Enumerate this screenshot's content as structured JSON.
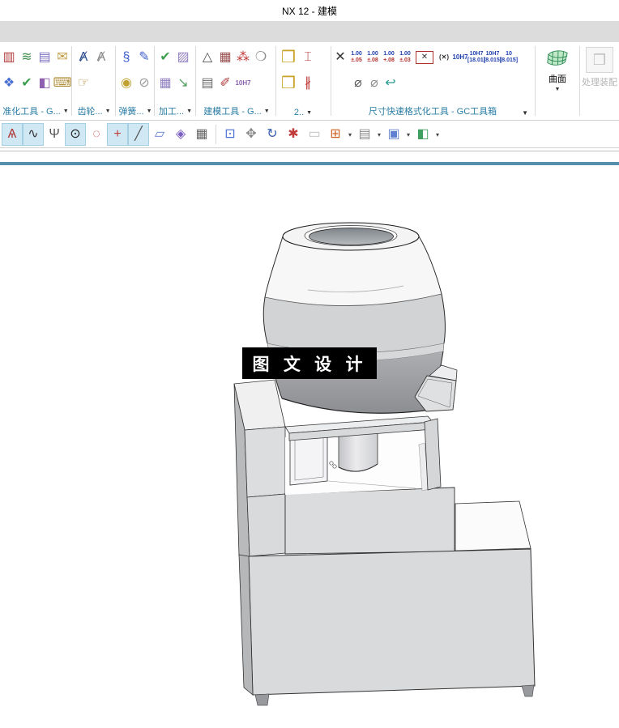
{
  "window": {
    "title": "NX 12 - 建模"
  },
  "glyphs": {
    "dropdown": "▼",
    "dropdown_small": "▾"
  },
  "colors": {
    "accent_line": "#568fab",
    "group_label_text": "#2a7da6",
    "menu_band": "#dcdcdc",
    "sketch_highlight": "#cfe8f4",
    "watermark_bg": "#000000",
    "watermark_fg": "#ffffff"
  },
  "ribbon": {
    "groups": [
      {
        "label": "准化工具 - G...",
        "row1": [
          {
            "n": "reuse-library-icon",
            "g": "▥",
            "c": "#b23b3b"
          },
          {
            "n": "layer-stack-icon",
            "g": "≋",
            "c": "#3f8f4f"
          },
          {
            "n": "layer-settings-icon",
            "g": "▤",
            "c": "#7a6fc0"
          },
          {
            "n": "note-tag-icon",
            "g": "✉",
            "c": "#c09a3e"
          }
        ],
        "row2": [
          {
            "n": "export-part-icon",
            "g": "❖",
            "c": "#4a6fd4"
          },
          {
            "n": "check-tool-icon",
            "g": "✔",
            "c": "#3f9f4f"
          },
          {
            "n": "check-cube-icon",
            "g": "◧",
            "c": "#8f5fb0"
          },
          {
            "n": "keyboard-macro-icon",
            "g": "⌨",
            "c": "#b08f3a"
          }
        ]
      },
      {
        "label": "齿轮...",
        "row1": [
          {
            "n": "gear-model-icon",
            "g": "Ⱥ",
            "c": "#2f4f8f"
          },
          {
            "n": "gear-modify-icon",
            "g": "Ⱥ",
            "c": "#8a8a8a"
          }
        ],
        "row2": [
          {
            "n": "gear-simulation-icon",
            "g": "☞",
            "c": "#b08f3a"
          }
        ]
      },
      {
        "label": "弹簧...",
        "row1": [
          {
            "n": "spring-coil-icon",
            "g": "§",
            "c": "#3f5fd0"
          },
          {
            "n": "spring-draw-icon",
            "g": "✎",
            "c": "#3f5fd0"
          }
        ],
        "row2": [
          {
            "n": "spring-disc-icon",
            "g": "◉",
            "c": "#c0a030"
          },
          {
            "n": "spring-delete-icon",
            "g": "⊘",
            "c": "#9a9a9a"
          }
        ]
      },
      {
        "label": "加工...",
        "row1": [
          {
            "n": "process-check-icon",
            "g": "✔",
            "c": "#3f9f4f"
          },
          {
            "n": "process-clipboard-icon",
            "g": "▨",
            "c": "#8f7fc0"
          }
        ],
        "row2": [
          {
            "n": "process-table-icon",
            "g": "▦",
            "c": "#8f7fc0"
          },
          {
            "n": "process-output-icon",
            "g": "↘",
            "c": "#4f9f5f"
          }
        ]
      },
      {
        "label": "建模工具 - G...",
        "row1": [
          {
            "n": "datum-triangle-icon",
            "g": "△",
            "c": "#555555"
          },
          {
            "n": "table-annotation-icon",
            "g": "▦",
            "c": "#9a4f4f"
          },
          {
            "n": "point-set-icon",
            "g": "⁂",
            "c": "#c03b3b"
          },
          {
            "n": "bubble-note-icon",
            "g": "❍",
            "c": "#8a8a8a"
          }
        ],
        "row2": [
          {
            "n": "text-note-icon",
            "g": "▤",
            "c": "#6a6a6a"
          },
          {
            "n": "dimension-brush-icon",
            "g": "✐",
            "c": "#b03b3b"
          },
          {
            "n": "fit-tolerance-icon",
            "g": "10H7",
            "c": "#8a5fb0",
            "small": true
          }
        ]
      },
      {
        "label": "2..",
        "row1": [
          {
            "n": "feature-box-icon",
            "g": "❒",
            "c": "#c9a227",
            "big": true
          },
          {
            "n": "dimension-bracket-icon",
            "g": "⌶",
            "c": "#b03b3b"
          }
        ],
        "row2": [
          {
            "n": "feature-box2-icon",
            "g": "❒",
            "c": "#c9a227",
            "big": true
          },
          {
            "n": "radial-dim-icon",
            "g": "∦",
            "c": "#c03b3b"
          }
        ]
      },
      {
        "label": "尺寸快速格式化工具 - GC工具箱",
        "row1": [
          {
            "n": "clear-tolerance-icon",
            "g": "✕",
            "c": "#333333"
          },
          {
            "n": "tolerance-05-icon",
            "top": "1.00",
            "bot": "±.05"
          },
          {
            "n": "tolerance-08-icon",
            "top": "1.00",
            "bot": "±.08"
          },
          {
            "n": "tolerance-plus08-icon",
            "top": "1.00",
            "bot": "+.08"
          },
          {
            "n": "tolerance-03-icon",
            "top": "1.00",
            "bot": "±.03"
          },
          {
            "n": "boxed-dim-icon",
            "g": "✕",
            "c": "#333333",
            "boxed": true
          },
          {
            "n": "paren-dim-icon",
            "g": "(✕)",
            "c": "#333333",
            "small": true
          },
          {
            "n": "fit-10h7-icon",
            "g": "10H7",
            "c": "#1f3fae",
            "small": true
          },
          {
            "n": "fit-stack1-icon",
            "top": "10H7",
            "bot": "[18.01]",
            "blue": true
          },
          {
            "n": "fit-stack2-icon",
            "top": "10H7",
            "bot": "[8.015]",
            "blue": true
          },
          {
            "n": "fit-stack3-icon",
            "top": "10",
            "bot": "[8.015]",
            "blue": true
          }
        ],
        "row2": [
          {
            "t": "gap"
          },
          {
            "n": "diameter-toggle-icon",
            "g": "⌀",
            "c": "#555555"
          },
          {
            "n": "diameter-slash-icon",
            "g": "⌀",
            "c": "#888888"
          },
          {
            "n": "undo-format-icon",
            "g": "↩",
            "c": "#2a9d8f"
          }
        ]
      }
    ],
    "surface_button": {
      "label": "曲面"
    },
    "assembly_button": {
      "label": "处理装配",
      "icon_glyph": "❒"
    }
  },
  "sketch_toolbar": {
    "icons": [
      {
        "n": "profile-polyline-icon",
        "g": "Ѧ",
        "c": "#b03b3b",
        "hl": true
      },
      {
        "n": "studio-spline-icon",
        "g": "∿",
        "c": "#333333",
        "hl": true
      },
      {
        "n": "point-tool-icon",
        "g": "Ψ",
        "c": "#555555"
      },
      {
        "n": "circle-center-icon",
        "g": "⊙",
        "c": "#222222",
        "hl": true
      },
      {
        "n": "circle-points-icon",
        "g": "◌",
        "c": "#c03b3b"
      },
      {
        "n": "point-plus-icon",
        "g": "+",
        "c": "#c03b3b",
        "hl": true
      },
      {
        "n": "line-tool-icon",
        "g": "╱",
        "c": "#555555",
        "hl": true
      },
      {
        "n": "quick-trim-icon",
        "g": "▱",
        "c": "#5f7fd0"
      },
      {
        "n": "mesh-surface-icon",
        "g": "◈",
        "c": "#7a5fc0"
      },
      {
        "n": "grid-table-icon",
        "g": "▦",
        "c": "#666666"
      },
      {
        "t": "sep"
      },
      {
        "n": "zoom-box-icon",
        "g": "⊡",
        "c": "#4a6fd4"
      },
      {
        "n": "pan-hand-icon",
        "g": "✥",
        "c": "#888888"
      },
      {
        "n": "rotate-view-icon",
        "g": "↻",
        "c": "#3a5fae"
      },
      {
        "n": "delete-curve-icon",
        "g": "✱",
        "c": "#c03b3b"
      },
      {
        "n": "sheet-disabled-icon",
        "g": "▭",
        "c": "#bdbdbd"
      },
      {
        "n": "snap-grid-icon",
        "g": "⊞",
        "c": "#d06020"
      },
      {
        "t": "dd",
        "n": "snap-grid"
      },
      {
        "n": "device-view-icon",
        "g": "▤",
        "c": "#8a8a8a"
      },
      {
        "t": "dd",
        "n": "device-view"
      },
      {
        "n": "shaded-view-icon",
        "g": "▣",
        "c": "#5f7fd0"
      },
      {
        "t": "dd",
        "n": "shaded-view"
      },
      {
        "n": "render-style-icon",
        "g": "◧",
        "c": "#3f9f5f"
      },
      {
        "t": "dd",
        "n": "render-style"
      }
    ]
  },
  "viewport": {
    "watermark": {
      "text": "图 文 设 计"
    }
  }
}
